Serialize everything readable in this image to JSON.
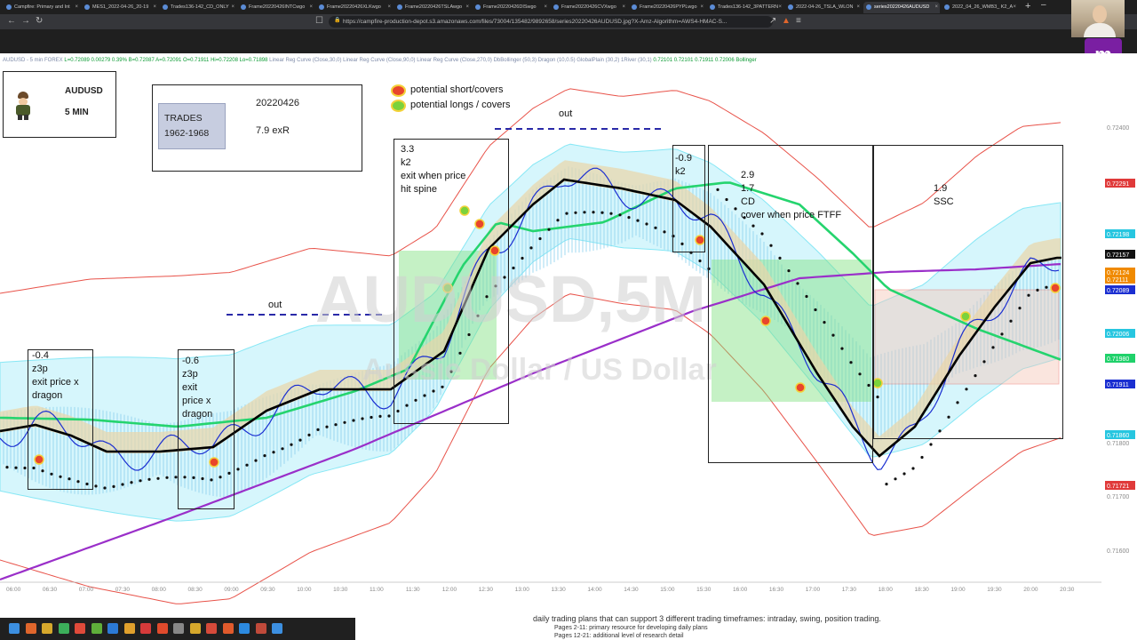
{
  "browser": {
    "tabs": [
      {
        "label": "Campfire: Primary and Int"
      },
      {
        "label": "MES1_2022-04-26_20-19"
      },
      {
        "label": "Trades136-142_CD_ONLY"
      },
      {
        "label": "Frame20220426INTCwgo"
      },
      {
        "label": "Frame20220426XLKwgo"
      },
      {
        "label": "Frame20220426TSLAwgo"
      },
      {
        "label": "Frame20220426DISwgo"
      },
      {
        "label": "Frame20220426CVXwgo"
      },
      {
        "label": "Frame20220426PYPLwgo"
      },
      {
        "label": "Trades136-142_3PATTERN"
      },
      {
        "label": "2022-04-26_TSLA_WLON"
      },
      {
        "label": "series20220426AUDUSD"
      },
      {
        "label": "2022_04_26_WMB3_ K2_A"
      }
    ],
    "active_tab_index": 11,
    "url": "https://campfire-production-depot.s3.amazonaws.com/files/73004/135482/9892658/series20220426AUDUSD.jpg?X-Amz-Algorithm=AWS4-HMAC-S..."
  },
  "overlay": {
    "badge_letter": "m"
  },
  "chart": {
    "info_strip": {
      "prefix": "AUDUSD - 5 min  FOREX",
      "values": "L=0.72089  0.00279  0.39%  B=0.72087  A=0.72091  O=0.71911  Hi=0.72208  Lo=0.71898",
      "studies": "Linear Reg Curve (Close,30,0)  Linear Reg Curve (Close,90,0)  Linear Reg Curve (Close,270,0)  DbBollinger (50,3)  Dragon (10,0.5)  GlobalPlain (30,2)  1River (30,1)",
      "right_values": "0.72101  0.72101  0.71911  0.72006  Bollinger"
    },
    "watermark": {
      "symbol": "AUDUSD,5M",
      "name": "Aussie Dollar / US Dollar"
    },
    "symbol_box": {
      "symbol": "AUDUSD",
      "timeframe": "5 MIN"
    },
    "trades_box": {
      "label_line1": "TRADES",
      "label_line2": "1962-1968",
      "date": "20220426",
      "result": "7.9 exR"
    },
    "legend": [
      {
        "label": "potential short/covers",
        "color": "#e8452c"
      },
      {
        "label": "potential longs / covers",
        "color": "#7bd23c"
      }
    ],
    "annotations": [
      {
        "id": "a1",
        "text": "-0.4\nz3p\nexit price x\ndragon"
      },
      {
        "id": "a2",
        "text": "-0.6\nz3p\nexit\nprice x\ndragon"
      },
      {
        "id": "a3",
        "text": "3.3\nk2\nexit when price\nhit spine"
      },
      {
        "id": "a4",
        "text": "-0.9\nk2"
      },
      {
        "id": "a5",
        "text": "2.9\n1.7\nCD\ncover when price FTFF"
      },
      {
        "id": "a6",
        "text": "1.9\nSSC"
      }
    ],
    "out_labels": [
      {
        "text": "out"
      },
      {
        "text": "out"
      }
    ],
    "price_scale": [
      {
        "text": "0.72400",
        "kind": "tick"
      },
      {
        "text": "0.72291",
        "kind": "flag",
        "color": "#e03a3a"
      },
      {
        "text": "0.72198",
        "kind": "flag",
        "color": "#27c6e0"
      },
      {
        "text": "0.72157",
        "kind": "flag",
        "color": "#111111"
      },
      {
        "text": "0.72124",
        "kind": "flag",
        "color": "#f08a00"
      },
      {
        "text": "0.72111",
        "kind": "flag",
        "color": "#f08a00"
      },
      {
        "text": "0.72089",
        "kind": "flag",
        "color": "#1b2fd1"
      },
      {
        "text": "0.72006",
        "kind": "flag",
        "color": "#27c6e0"
      },
      {
        "text": "0.71980",
        "kind": "flag",
        "color": "#1fd16a"
      },
      {
        "text": "0.71911",
        "kind": "flag",
        "color": "#1b2fd1"
      },
      {
        "text": "0.71860",
        "kind": "flag",
        "color": "#27c6e0"
      },
      {
        "text": "0.71800",
        "kind": "tick"
      },
      {
        "text": "0.71721",
        "kind": "flag",
        "color": "#e03a3a"
      },
      {
        "text": "0.71700",
        "kind": "tick"
      },
      {
        "text": "0.71600",
        "kind": "tick"
      }
    ],
    "time_labels": [
      "06:00",
      "06:30",
      "07:00",
      "07:30",
      "08:00",
      "08:30",
      "09:00",
      "09:30",
      "10:00",
      "10:30",
      "11:00",
      "11:30",
      "12:00",
      "12:30",
      "13:00",
      "13:30",
      "14:00",
      "14:30",
      "15:00",
      "15:30",
      "16:00",
      "16:30",
      "17:00",
      "17:30",
      "18:00",
      "18:30",
      "19:00",
      "19:30",
      "20:00",
      "20:30"
    ]
  },
  "document": {
    "line1": "daily trading plans that can support 3 different trading timeframes: intraday, swing, position trading.",
    "line2": "Pages 2-11: primary resource for developing daily plans",
    "line3": "Pages 12-21: additional level of research detail"
  }
}
